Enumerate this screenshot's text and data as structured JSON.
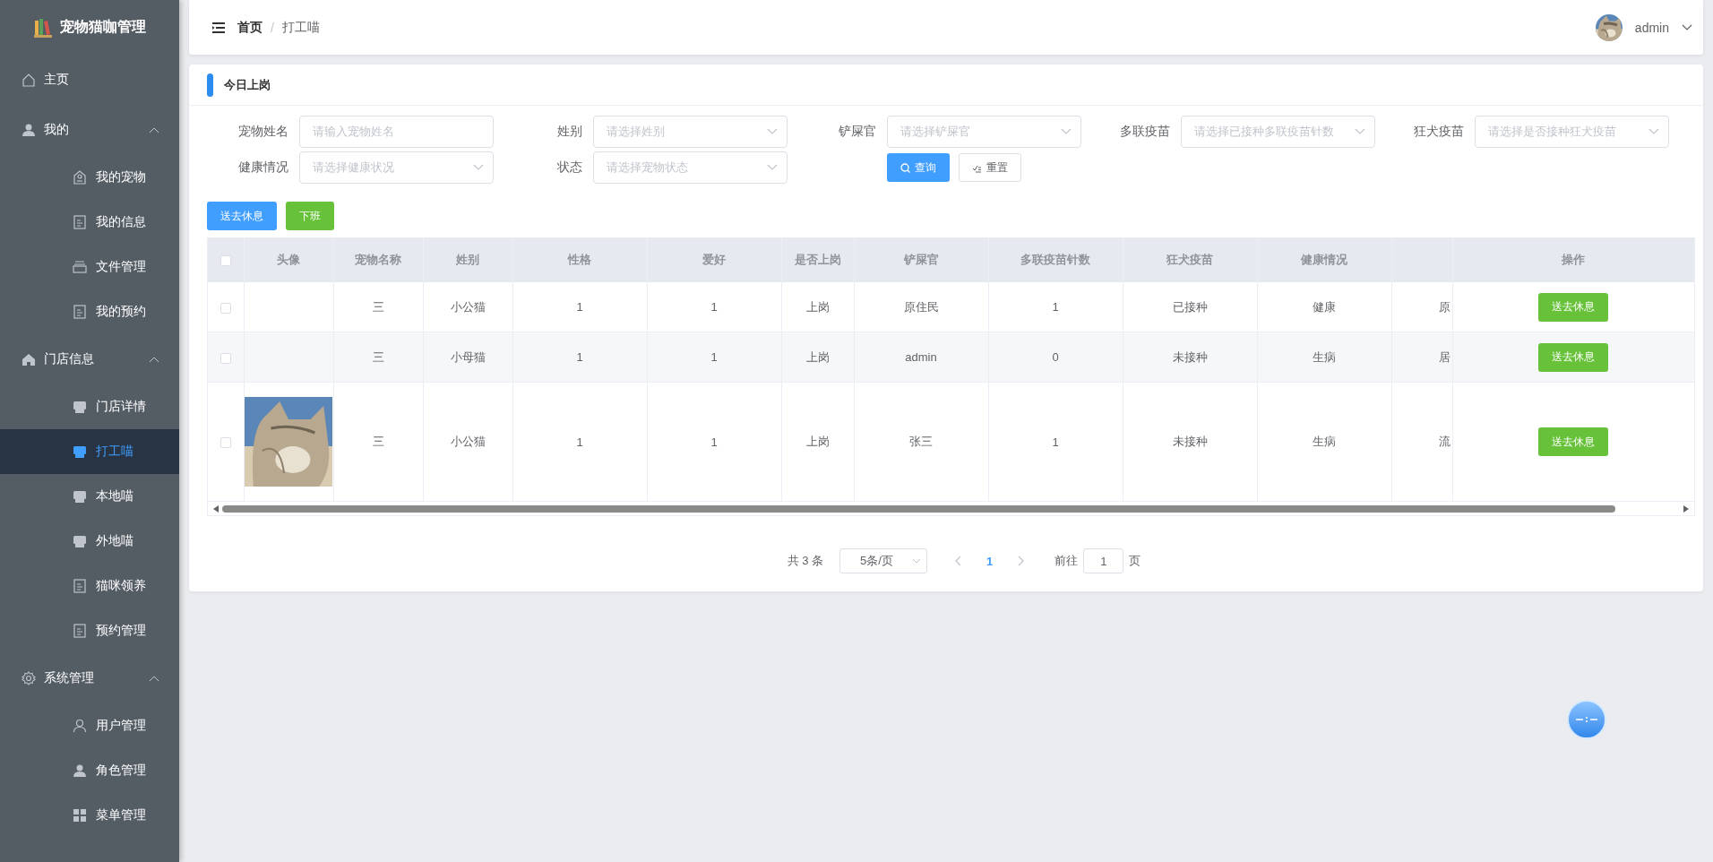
{
  "sidebar": {
    "title": "宠物猫咖管理",
    "menu": [
      {
        "label": "主页",
        "selected": false
      },
      {
        "label": "我的",
        "expanded": true,
        "children": [
          {
            "label": "我的宠物",
            "selected": false
          },
          {
            "label": "我的信息",
            "selected": false
          },
          {
            "label": "文件管理",
            "selected": false
          },
          {
            "label": "我的预约",
            "selected": false
          }
        ]
      },
      {
        "label": "门店信息",
        "expanded": true,
        "children": [
          {
            "label": "门店详情",
            "selected": false
          },
          {
            "label": "打工喵",
            "selected": true
          },
          {
            "label": "本地喵",
            "selected": false
          },
          {
            "label": "外地喵",
            "selected": false
          },
          {
            "label": "猫咪领养",
            "selected": false
          },
          {
            "label": "预约管理",
            "selected": false
          }
        ]
      },
      {
        "label": "系统管理",
        "expanded": true,
        "children": [
          {
            "label": "用户管理",
            "selected": false
          },
          {
            "label": "角色管理",
            "selected": false
          },
          {
            "label": "菜单管理",
            "selected": false
          }
        ]
      }
    ]
  },
  "header": {
    "breadcrumb": [
      {
        "label": "首页"
      },
      {
        "label": "打工喵"
      }
    ],
    "separator": "/",
    "user": "admin"
  },
  "card": {
    "title": "今日上岗",
    "filters": [
      {
        "kind": "input",
        "label": "宠物姓名",
        "placeholder": "请输入宠物姓名"
      },
      {
        "kind": "select",
        "label": "姓别",
        "placeholder": "请选择姓别"
      },
      {
        "kind": "select",
        "label": "铲屎官",
        "placeholder": "请选择铲屎官"
      },
      {
        "kind": "select",
        "label": "多联疫苗",
        "placeholder": "请选择已接种多联疫苗针数"
      },
      {
        "kind": "select",
        "label": "狂犬疫苗",
        "placeholder": "请选择是否接种狂犬疫苗"
      },
      {
        "kind": "select",
        "label": "健康情况",
        "placeholder": "请选择健康状况"
      },
      {
        "kind": "select",
        "label": "状态",
        "placeholder": "请选择宠物状态"
      }
    ],
    "filter_buttons": [
      {
        "kind": "primary",
        "label": "查询"
      },
      {
        "kind": "plain",
        "label": "重置"
      }
    ],
    "actions": [
      {
        "kind": "primary",
        "label": "送去休息"
      },
      {
        "kind": "success",
        "label": "下班"
      }
    ],
    "table": {
      "select_all": {
        "checked": false
      },
      "columns": [
        "头像",
        "宠物名称",
        "姓别",
        "性格",
        "爱好",
        "是否上岗",
        "铲屎官",
        "多联疫苗针数",
        "狂犬疫苗",
        "健康情况",
        "",
        "操作"
      ],
      "rows": [
        {
          "checked": false,
          "cells": [
            "",
            "三",
            "小公猫",
            "1",
            "1",
            "上岗",
            "原住民",
            "1",
            "已接种",
            "健康",
            "原",
            "送去休息"
          ]
        },
        {
          "checked": false,
          "cells": [
            "",
            "三",
            "小母猫",
            "1",
            "1",
            "上岗",
            "admin",
            "0",
            "未接种",
            "生病",
            "居",
            "送去休息"
          ]
        },
        {
          "checked": false,
          "cells": [
            "",
            "三",
            "小公猫",
            "1",
            "1",
            "上岗",
            "张三",
            "1",
            "未接种",
            "生病",
            "流",
            "送去休息"
          ]
        }
      ]
    },
    "pagination": {
      "total": "共 3 条",
      "page_size": "5条/页",
      "pages": [
        {
          "label": "1",
          "selected": true
        }
      ],
      "jump_label": "前往",
      "jump_value": "1",
      "jump_suffix": "页"
    }
  }
}
